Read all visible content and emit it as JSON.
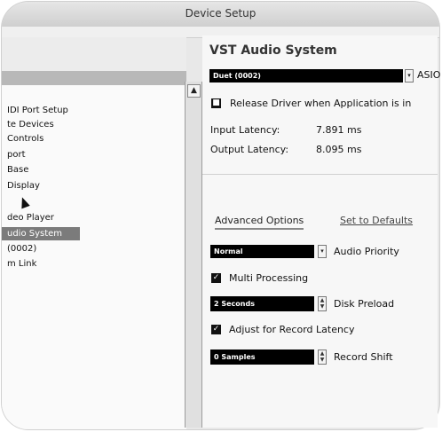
{
  "window": {
    "title": "Device Setup"
  },
  "tree": {
    "items": [
      "IDI Port Setup",
      "te Devices",
      " Controls",
      "port",
      "Base",
      " Display",
      "",
      "deo Player",
      "udio System",
      "(0002)",
      "m Link"
    ],
    "selected_index": 8
  },
  "vst": {
    "heading": "VST Audio System",
    "driver_value": "Duet (0002)",
    "driver_label": "ASIO",
    "release_driver_label": "Release Driver when Application is in",
    "release_driver_checked": true,
    "input_latency_label": "Input Latency:",
    "input_latency_value": "7.891 ms",
    "output_latency_label": "Output Latency:",
    "output_latency_value": "8.095 ms"
  },
  "tabs": {
    "advanced": "Advanced Options",
    "defaults": "Set to Defaults"
  },
  "advanced": {
    "priority_value": "Normal",
    "priority_label": "Audio Priority",
    "multi_label": "Multi Processing",
    "multi_checked": true,
    "preload_value": "2 Seconds",
    "preload_label": "Disk Preload",
    "adjust_label": "Adjust for Record Latency",
    "adjust_checked": true,
    "shift_value": "0 Samples",
    "shift_label": "Record Shift"
  }
}
